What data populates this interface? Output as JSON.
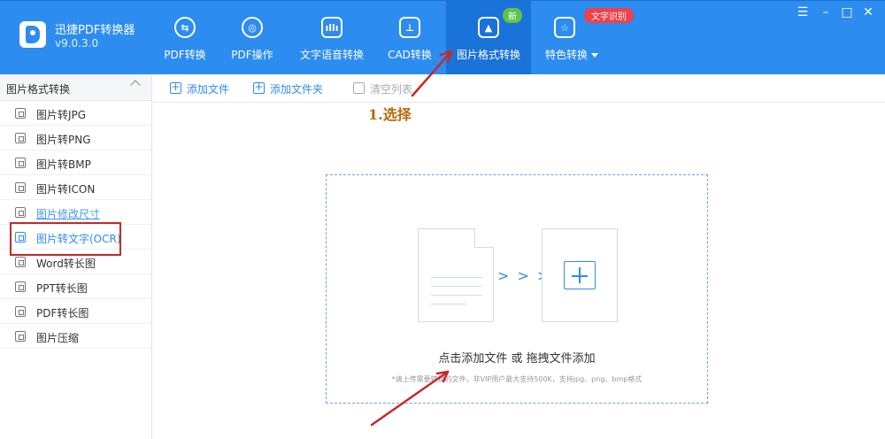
{
  "app": {
    "name": "迅捷PDF转换器",
    "version": "v9.0.3.0"
  },
  "nav": {
    "tabs": [
      {
        "label": "PDF转换",
        "icon": "pdf-convert-icon"
      },
      {
        "label": "PDF操作",
        "icon": "pdf-operation-icon"
      },
      {
        "label": "文字语音转换",
        "icon": "text-speech-icon"
      },
      {
        "label": "CAD转换",
        "icon": "cad-convert-icon"
      },
      {
        "label": "图片格式转换",
        "icon": "image-format-icon",
        "active": true,
        "badge": "新"
      },
      {
        "label": "特色转换",
        "icon": "special-convert-icon",
        "badge": "文字识别"
      }
    ]
  },
  "window_controls": [
    "menu-icon",
    "minimize-icon",
    "maximize-icon",
    "close-icon"
  ],
  "sidebar": {
    "title": "图片格式转换",
    "items": [
      {
        "label": "图片转JPG"
      },
      {
        "label": "图片转PNG"
      },
      {
        "label": "图片转BMP"
      },
      {
        "label": "图片转ICON"
      },
      {
        "label": "图片修改尺寸"
      },
      {
        "label": "图片转文字(OCR)",
        "active": true
      },
      {
        "label": "Word转长图"
      },
      {
        "label": "PPT转长图"
      },
      {
        "label": "PDF转长图"
      },
      {
        "label": "图片压缩"
      }
    ]
  },
  "toolbar": {
    "add_file": "添加文件",
    "add_folder": "添加文件夹",
    "clear_list": "清空列表"
  },
  "annotation": {
    "step_label": "1.选择",
    "color": "#c32a2a"
  },
  "dropzone": {
    "main_text": "点击添加文件 或 拖拽文件添加",
    "hint": "*请上传需要转换的文件，非VIP用户最大支持500K，支持jpg、png、bmp格式",
    "arrows": "> > >"
  },
  "colors": {
    "brand": "#2d8cf0",
    "active_tab": "#1a73d9",
    "badge_new": "#5fc24a",
    "badge_ocr": "#f0414b"
  }
}
